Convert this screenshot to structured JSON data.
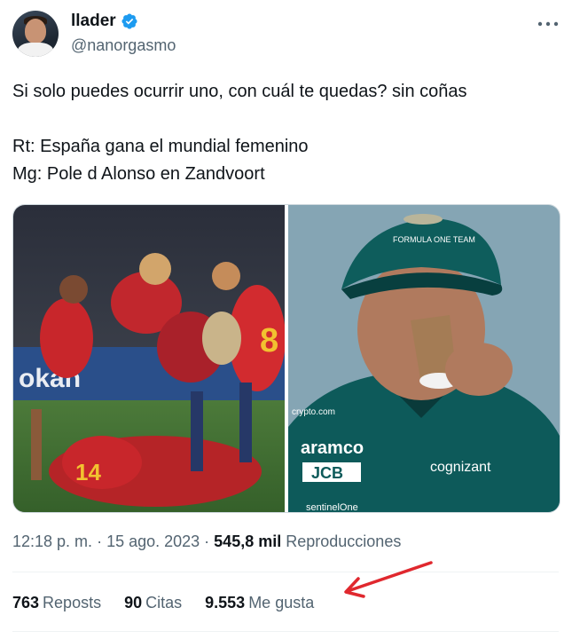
{
  "author": {
    "display_name": "llader",
    "handle": "@nanorgasmo",
    "verified": true
  },
  "tweet": {
    "line1": "Si solo puedes ocurrir uno, con cuál te quedas? sin coñas",
    "line2": "Rt: España gana el mundial femenino",
    "line3": "Mg: Pole d Alonso en Zandvoort"
  },
  "media": {
    "left_image": "spain-women-football-celebration-photo",
    "right_image": "fernando-alonso-drinking-coffee-photo",
    "right_image_texts": {
      "cap_text": "FORMULA ONE TEAM",
      "suit_brand_1": "aramco",
      "suit_brand_2": "JCB",
      "suit_brand_3": "cognizant",
      "suit_brand_4": "sentinelOne",
      "suit_brand_5": "crypto.com"
    }
  },
  "meta": {
    "time": "12:18 p. m.",
    "separator": " · ",
    "date": "15 ago. 2023",
    "views_value": "545,8 mil",
    "views_label": "Reproducciones"
  },
  "stats": {
    "reposts_value": "763",
    "reposts_label": "Reposts",
    "quotes_value": "90",
    "quotes_label": "Citas",
    "likes_value": "9.553",
    "likes_label": "Me gusta"
  },
  "colors": {
    "accent": "#1d9bf0",
    "secondary_text": "#536471",
    "annotation_arrow": "#e0282e"
  }
}
